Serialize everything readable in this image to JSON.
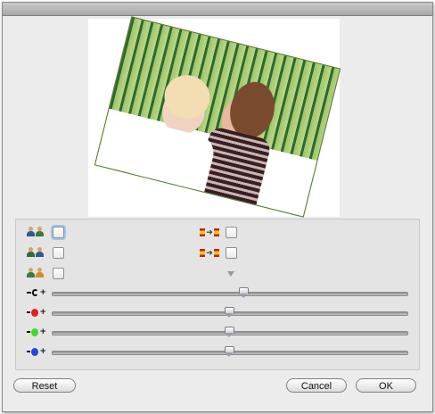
{
  "window": {
    "accent": "#ececec"
  },
  "preview": {
    "image_icon": "photo-preview"
  },
  "options": {
    "rows": [
      {
        "left_icon": "people-swap-icon",
        "right_icon": "flag-arrow-icon"
      },
      {
        "left_icon": "people-swap-alt-icon",
        "right_icon": "flag-arrow-icon"
      },
      {
        "left_icon": "people-pair-icon"
      }
    ]
  },
  "sliders": [
    {
      "icon": "rotate-icon",
      "value_fraction": 0.54
    },
    {
      "icon": "red-channel-icon",
      "color": "#e21e1e",
      "value_fraction": 0.5
    },
    {
      "icon": "green-channel-icon",
      "color": "#3fdc2a",
      "value_fraction": 0.5
    },
    {
      "icon": "blue-channel-icon",
      "color": "#1f44e0",
      "value_fraction": 0.5
    }
  ],
  "buttons": {
    "reset": "Reset",
    "cancel": "Cancel",
    "ok": "OK"
  }
}
